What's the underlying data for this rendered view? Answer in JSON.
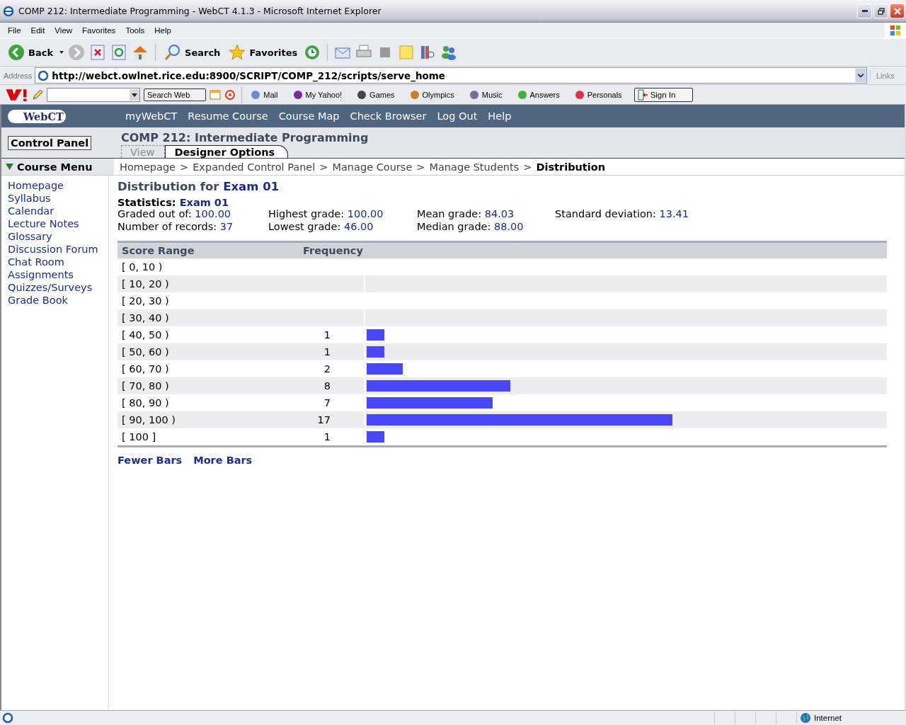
{
  "window": {
    "title": "COMP 212: Intermediate Programming - WebCT 4.1.3 - Microsoft Internet Explorer"
  },
  "menu_bar": [
    "File",
    "Edit",
    "View",
    "Favorites",
    "Tools",
    "Help"
  ],
  "toolbar": {
    "back": "Back",
    "search": "Search",
    "favorites": "Favorites"
  },
  "address": {
    "label": "Address",
    "value": "http://webct.owlnet.rice.edu:8900/SCRIPT/COMP_212/scripts/serve_home",
    "links": "Links"
  },
  "yahoo_toolbar": {
    "search_button": "Search Web",
    "items": [
      "Mail",
      "My Yahoo!",
      "Games",
      "Olympics",
      "Music",
      "Answers",
      "Personals"
    ],
    "sign_in": "Sign In"
  },
  "webct": {
    "logo": "WebCT",
    "nav": [
      "myWebCT",
      "Resume Course",
      "Course Map",
      "Check Browser",
      "Log Out",
      "Help"
    ],
    "control_panel": "Control Panel",
    "course_title": "COMP 212: Intermediate Programming",
    "tabs": [
      {
        "label": "View",
        "selected": false
      },
      {
        "label": "Designer Options",
        "selected": true
      }
    ],
    "course_menu": "Course Menu",
    "menu_items": [
      "Homepage",
      "Syllabus",
      "Calendar",
      "Lecture Notes",
      "Glossary",
      "Discussion Forum",
      "Chat Room",
      "Assignments",
      "Quizzes/Surveys",
      "Grade Book"
    ],
    "breadcrumb": [
      "Homepage",
      "Expanded Control Panel",
      "Manage Course",
      "Manage Students"
    ],
    "separator": ">",
    "current": "Distribution"
  },
  "heading": {
    "prefix": "Distribution for",
    "name": "Exam 01"
  },
  "statistics": {
    "label": "Statistics:",
    "name": "Exam 01"
  },
  "stats": [
    {
      "label": "Graded out of:",
      "value": "100.00"
    },
    {
      "label": "Number of records:",
      "value": "37"
    },
    {
      "label": "Highest grade:",
      "value": "100.00"
    },
    {
      "label": "Lowest grade:",
      "value": "46.00"
    },
    {
      "label": "Mean grade:",
      "value": "84.03"
    },
    {
      "label": "Median grade:",
      "value": "88.00"
    },
    {
      "label": "Standard deviation:",
      "value": "13.41"
    }
  ],
  "table": {
    "columns": [
      "Score Range",
      "Frequency"
    ],
    "rows": [
      {
        "range": "[ 0, 10 )"
      },
      {
        "range": "[ 10, 20 )"
      },
      {
        "range": "[ 20, 30 )"
      },
      {
        "range": "[ 30, 40 )"
      },
      {
        "range": "[ 40, 50 )",
        "frequency": "1"
      },
      {
        "range": "[ 50, 60 )",
        "frequency": "1"
      },
      {
        "range": "[ 60, 70 )",
        "frequency": "2"
      },
      {
        "range": "[ 70, 80 )",
        "frequency": "8"
      },
      {
        "range": "[ 80, 90 )",
        "frequency": "7"
      },
      {
        "range": "[ 90, 100 )",
        "frequency": "17"
      },
      {
        "range": "[ 100 ]",
        "frequency": "1"
      }
    ]
  },
  "bar_links": [
    "Fewer Bars",
    "More Bars"
  ],
  "status_bar": {
    "zone": "Internet"
  }
}
